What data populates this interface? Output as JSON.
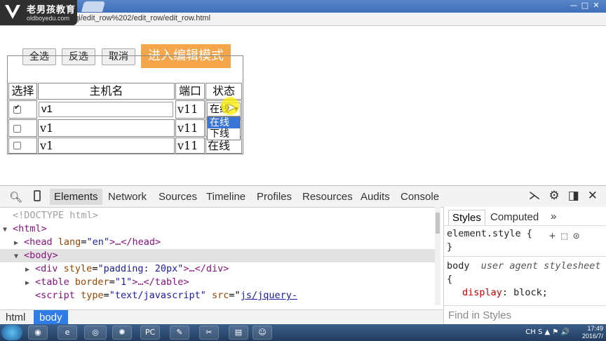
{
  "browser": {
    "url": "file:///E:/wupeiqi/edit_row%202/edit_row/edit_row.html",
    "url_visible": "E:/wupeiqi/edit_row%202/edit_row/edit_row.html",
    "refresh_icon": "refresh-icon",
    "window_controls": [
      "—",
      "□",
      "✕"
    ]
  },
  "logo": {
    "brand_cn": "老男孩教育",
    "brand_en": "oldboyedu.com"
  },
  "toolbar": {
    "select_all_label": "全选",
    "invert_label": "反选",
    "cancel_label": "取消",
    "edit_mode_label": "进入编辑模式",
    "edit_mode_color": "#f5a54a"
  },
  "table": {
    "headers": [
      "选择",
      "主机名",
      "端口",
      "状态"
    ],
    "rows": [
      {
        "checked": true,
        "host": "v1",
        "port": "v11",
        "status": "在线"
      },
      {
        "checked": false,
        "host": "v1",
        "port": "v11",
        "status": ""
      },
      {
        "checked": false,
        "host": "v1",
        "port": "v11",
        "status": "在线"
      }
    ],
    "dropdown_options": [
      "在线",
      "下线"
    ],
    "dropdown_selected": "在线"
  },
  "devtools": {
    "tabs": [
      "Elements",
      "Network",
      "Sources",
      "Timeline",
      "Profiles",
      "Resources",
      "Audits",
      "Console"
    ],
    "active_tab": "Elements",
    "dom_lines": {
      "doctype": "<!DOCTYPE html>",
      "html_open": "<html>",
      "head_tag": "head",
      "head_attr": "lang",
      "head_val": "\"en\"",
      "head_rest": ">…</head>",
      "body_open": "<body>",
      "div_tag": "div",
      "div_attr": "style",
      "div_val": "\"padding: 20px\"",
      "div_rest": ">…</div>",
      "table_tag": "table",
      "table_attr": "border",
      "table_val": "\"1\"",
      "table_rest": ">…</table>",
      "script_tag": "script",
      "script_attr1": "type",
      "script_val1": "\"text/javascript\"",
      "script_attr2": "src",
      "script_val2": "js/jquery-"
    },
    "styles_tabs": [
      "Styles",
      "Computed",
      "»"
    ],
    "element_style": "element.style {",
    "element_style_close": "}",
    "rule_selector": "body",
    "rule_origin": "user agent stylesheet",
    "rule_open": "{",
    "rule_prop": "display",
    "rule_value": "block;",
    "find_placeholder": "Find in Styles",
    "breadcrumb": [
      "html",
      "body"
    ],
    "breadcrumb_active_color": "#2f7be8"
  },
  "taskbar": {
    "time": "17:49",
    "date": "2016/7/",
    "tray_lang": "CH",
    "tray_glyphs": "S ▲ ⚑ 🔊"
  }
}
